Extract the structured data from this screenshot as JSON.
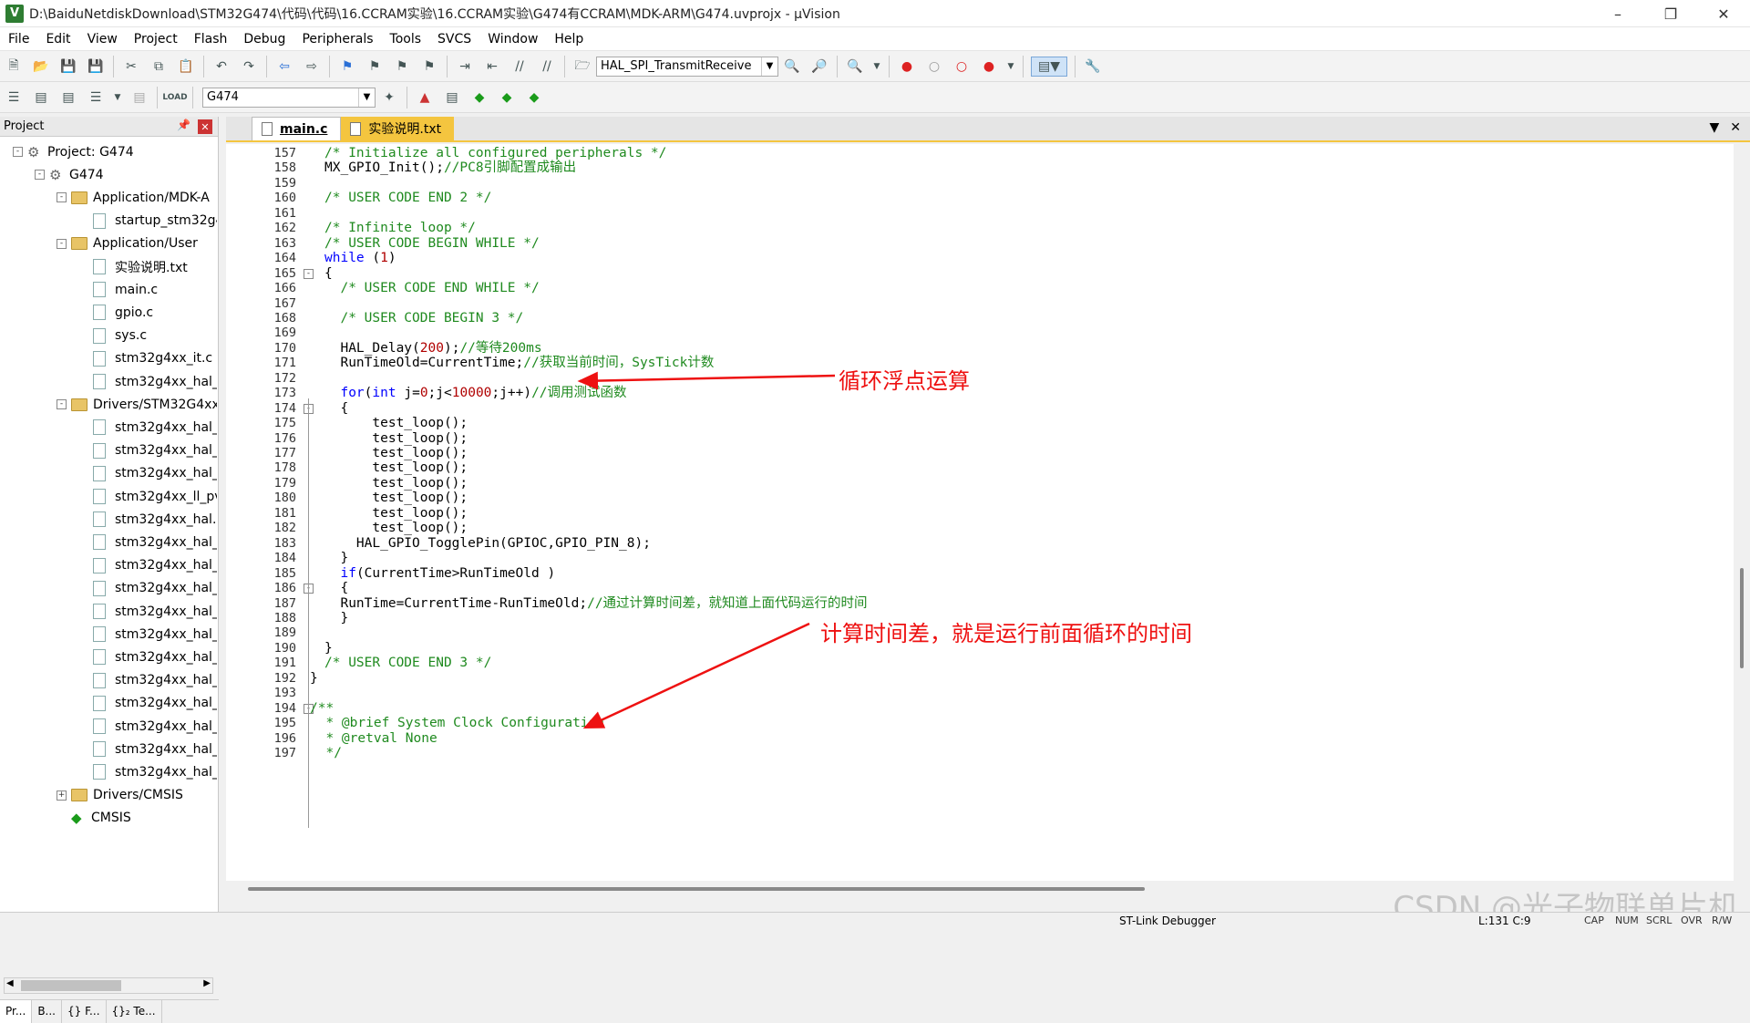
{
  "window": {
    "title": "D:\\BaiduNetdiskDownload\\STM32G474\\代码\\代码\\16.CCRAM实验\\16.CCRAM实验\\G474有CCRAM\\MDK-ARM\\G474.uvprojx - µVision",
    "app_icon": "V"
  },
  "menu": [
    "File",
    "Edit",
    "View",
    "Project",
    "Flash",
    "Debug",
    "Peripherals",
    "Tools",
    "SVCS",
    "Window",
    "Help"
  ],
  "toolbar": {
    "function_combo": "HAL_SPI_TransmitReceive",
    "target_combo": "G474"
  },
  "project_panel": {
    "title": "Project",
    "tree": [
      {
        "label": "Project: G474",
        "icon": "gear"
      },
      {
        "label": "G474",
        "icon": "gear"
      },
      {
        "label": "Application/MDK-A",
        "icon": "folder"
      },
      {
        "label": "startup_stm32g4",
        "icon": "file"
      },
      {
        "label": "Application/User",
        "icon": "folder"
      },
      {
        "label": "实验说明.txt",
        "icon": "file"
      },
      {
        "label": "main.c",
        "icon": "file"
      },
      {
        "label": "gpio.c",
        "icon": "file"
      },
      {
        "label": "sys.c",
        "icon": "file"
      },
      {
        "label": "stm32g4xx_it.c",
        "icon": "file"
      },
      {
        "label": "stm32g4xx_hal_",
        "icon": "file"
      },
      {
        "label": "Drivers/STM32G4xx_",
        "icon": "folder"
      },
      {
        "label": "stm32g4xx_hal_",
        "icon": "file"
      },
      {
        "label": "stm32g4xx_hal_",
        "icon": "file"
      },
      {
        "label": "stm32g4xx_hal_",
        "icon": "file"
      },
      {
        "label": "stm32g4xx_ll_pv",
        "icon": "file"
      },
      {
        "label": "stm32g4xx_hal.c",
        "icon": "file"
      },
      {
        "label": "stm32g4xx_hal_",
        "icon": "file"
      },
      {
        "label": "stm32g4xx_hal_",
        "icon": "file"
      },
      {
        "label": "stm32g4xx_hal_",
        "icon": "file"
      },
      {
        "label": "stm32g4xx_hal_",
        "icon": "file"
      },
      {
        "label": "stm32g4xx_hal_",
        "icon": "file"
      },
      {
        "label": "stm32g4xx_hal_",
        "icon": "file"
      },
      {
        "label": "stm32g4xx_hal_",
        "icon": "file"
      },
      {
        "label": "stm32g4xx_hal_",
        "icon": "file"
      },
      {
        "label": "stm32g4xx_hal_",
        "icon": "file"
      },
      {
        "label": "stm32g4xx_hal_",
        "icon": "file"
      },
      {
        "label": "stm32g4xx_hal_",
        "icon": "file"
      },
      {
        "label": "Drivers/CMSIS",
        "icon": "folder"
      },
      {
        "label": "CMSIS",
        "icon": "cmsis"
      }
    ],
    "tabs": [
      "Pr...",
      "B...",
      "{} F...",
      "{}₂ Te..."
    ]
  },
  "editor": {
    "tabs": [
      "main.c",
      "实验说明.txt"
    ],
    "lines": [
      {
        "n": "157",
        "segs": [
          [
            "c",
            "/* Initialize all configured peripherals */"
          ]
        ]
      },
      {
        "n": "158",
        "segs": [
          [
            "p",
            "MX_GPIO_Init();"
          ],
          [
            "c",
            "//PC8引脚配置成输出"
          ]
        ]
      },
      {
        "n": "159",
        "segs": []
      },
      {
        "n": "160",
        "segs": [
          [
            "c",
            "/* USER CODE END 2 */"
          ]
        ]
      },
      {
        "n": "161",
        "segs": []
      },
      {
        "n": "162",
        "segs": [
          [
            "c",
            "/* Infinite loop */"
          ]
        ]
      },
      {
        "n": "163",
        "segs": [
          [
            "c",
            "/* USER CODE BEGIN WHILE */"
          ]
        ]
      },
      {
        "n": "164",
        "segs": [
          [
            "k",
            "while"
          ],
          [
            "p",
            " ("
          ],
          [
            "n",
            "1"
          ],
          [
            "p",
            ")"
          ]
        ]
      },
      {
        "n": "165",
        "segs": [
          [
            "p",
            "{"
          ]
        ]
      },
      {
        "n": "166",
        "segs": [
          [
            "p",
            "  "
          ],
          [
            "c",
            "/* USER CODE END WHILE */"
          ]
        ]
      },
      {
        "n": "167",
        "segs": []
      },
      {
        "n": "168",
        "segs": [
          [
            "p",
            "  "
          ],
          [
            "c",
            "/* USER CODE BEGIN 3 */"
          ]
        ]
      },
      {
        "n": "169",
        "segs": []
      },
      {
        "n": "170",
        "segs": [
          [
            "p",
            "  HAL_Delay("
          ],
          [
            "n",
            "200"
          ],
          [
            "p",
            ");"
          ],
          [
            "c",
            "//等待200ms"
          ]
        ]
      },
      {
        "n": "171",
        "segs": [
          [
            "p",
            "  RunTimeOld=CurrentTime;"
          ],
          [
            "c",
            "//获取当前时间，SysTick计数"
          ]
        ]
      },
      {
        "n": "172",
        "segs": []
      },
      {
        "n": "173",
        "segs": [
          [
            "p",
            "  "
          ],
          [
            "k",
            "for"
          ],
          [
            "p",
            "("
          ],
          [
            "k",
            "int"
          ],
          [
            "p",
            " j="
          ],
          [
            "n",
            "0"
          ],
          [
            "p",
            ";j<"
          ],
          [
            "n",
            "10000"
          ],
          [
            "p",
            ";j++)"
          ],
          [
            "c",
            "//调用测试函数"
          ]
        ]
      },
      {
        "n": "174",
        "segs": [
          [
            "p",
            "  {"
          ]
        ]
      },
      {
        "n": "175",
        "segs": [
          [
            "p",
            "      test_loop();"
          ]
        ]
      },
      {
        "n": "176",
        "segs": [
          [
            "p",
            "      test_loop();"
          ]
        ]
      },
      {
        "n": "177",
        "segs": [
          [
            "p",
            "      test_loop();"
          ]
        ]
      },
      {
        "n": "178",
        "segs": [
          [
            "p",
            "      test_loop();"
          ]
        ]
      },
      {
        "n": "179",
        "segs": [
          [
            "p",
            "      test_loop();"
          ]
        ]
      },
      {
        "n": "180",
        "segs": [
          [
            "p",
            "      test_loop();"
          ]
        ]
      },
      {
        "n": "181",
        "segs": [
          [
            "p",
            "      test_loop();"
          ]
        ]
      },
      {
        "n": "182",
        "segs": [
          [
            "p",
            "      test_loop();"
          ]
        ]
      },
      {
        "n": "183",
        "segs": [
          [
            "p",
            "    HAL_GPIO_TogglePin(GPIOC,GPIO_PIN_8);"
          ]
        ]
      },
      {
        "n": "184",
        "segs": [
          [
            "p",
            "  }"
          ]
        ]
      },
      {
        "n": "185",
        "segs": [
          [
            "p",
            "  "
          ],
          [
            "k",
            "if"
          ],
          [
            "p",
            "(CurrentTime>RunTimeOld )"
          ]
        ]
      },
      {
        "n": "186",
        "segs": [
          [
            "p",
            "  {"
          ]
        ]
      },
      {
        "n": "187",
        "segs": [
          [
            "p",
            "  RunTime=CurrentTime-RunTimeOld;"
          ],
          [
            "c",
            "//通过计算时间差，就知道上面代码运行的时间"
          ]
        ]
      },
      {
        "n": "188",
        "segs": [
          [
            "p",
            "  }"
          ]
        ]
      },
      {
        "n": "189",
        "segs": []
      },
      {
        "n": "190",
        "segs": [
          [
            "p",
            "}"
          ]
        ]
      },
      {
        "n": "191",
        "segs": [
          [
            "c",
            "/* USER CODE END 3 */"
          ]
        ]
      },
      {
        "n": "192",
        "segs": [
          [
            "p",
            "}"
          ]
        ]
      },
      {
        "n": "193",
        "segs": []
      },
      {
        "n": "194",
        "segs": [
          [
            "c",
            "/**"
          ]
        ]
      },
      {
        "n": "195",
        "segs": [
          [
            "c",
            "  * @brief System Clock Configuration"
          ]
        ]
      },
      {
        "n": "196",
        "segs": [
          [
            "c",
            "  * @retval None"
          ]
        ]
      },
      {
        "n": "197",
        "segs": [
          [
            "c",
            "  */"
          ]
        ]
      }
    ],
    "annotations": [
      "循环浮点运算",
      "计算时间差，就是运行前面循环的时间"
    ]
  },
  "status": {
    "debugger": "ST-Link Debugger",
    "position": "L:131 C:9",
    "keys": [
      "CAP",
      "NUM",
      "SCRL",
      "OVR",
      "R/W"
    ]
  },
  "watermark": "CSDN @光子物联单片机",
  "colors": {
    "comment": "#1f8a1f",
    "keyword": "#0000ff",
    "number": "#b00000",
    "annotation": "#ee1111",
    "active_tab": "#f4c53f"
  }
}
